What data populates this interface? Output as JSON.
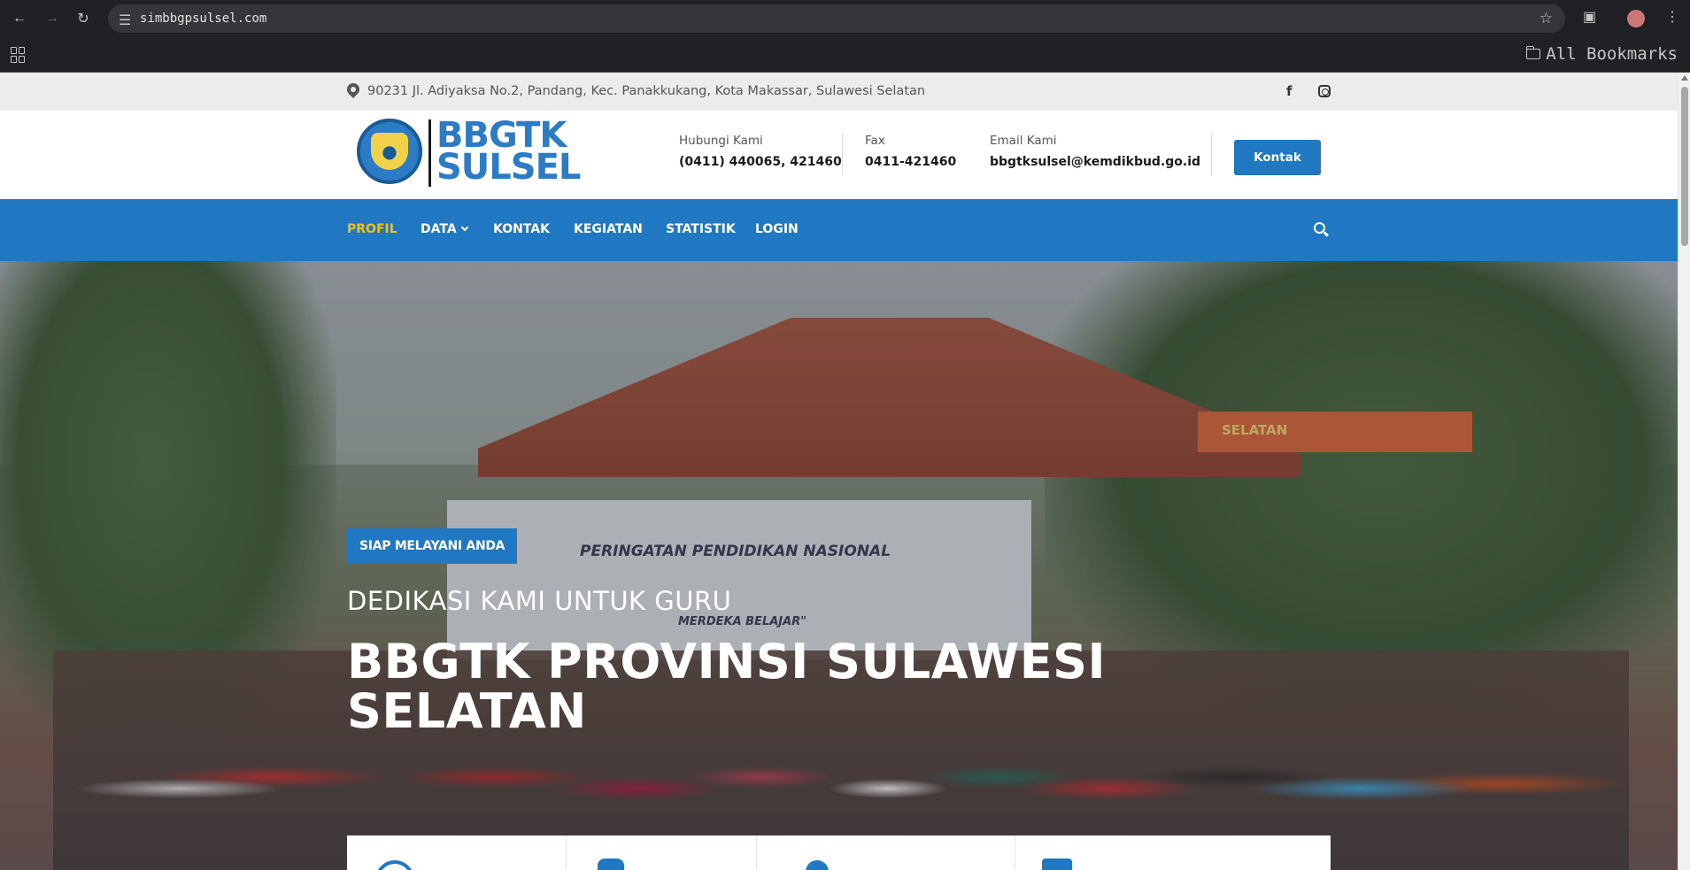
{
  "browser": {
    "url": "simbbgpsulsel.com",
    "bookmarks_label": "All Bookmarks"
  },
  "topbar": {
    "address": "90231 Jl. Adiyaksa No.2, Pandang, Kec. Panakkukang, Kota Makassar, Sulawesi Selatan",
    "facebook_glyph": "f"
  },
  "header": {
    "logo_line1": "BBGTK",
    "logo_line2": "SULSEL",
    "contacts": [
      {
        "label": "Hubungi Kami",
        "value": "(0411) 440065, 421460"
      },
      {
        "label": "Fax",
        "value": "0411-421460"
      },
      {
        "label": "Email Kami",
        "value": "bbgtksulsel@kemdikbud.go.id"
      }
    ],
    "cta_label": "Kontak"
  },
  "nav": {
    "items": [
      "PROFIL",
      "DATA",
      "KONTAK",
      "KEGIATAN",
      "STATISTIK",
      "LOGIN"
    ],
    "active_color": "#f1c40f"
  },
  "hero": {
    "badge": "SIAP MELAYANI ANDA",
    "subtitle": "DEDIKASI KAMI UNTUK GURU",
    "title": "BBGTK PROVINSI SULAWESI SELATAN",
    "banner_line1": "PERINGATAN PENDIDIKAN NASIONAL",
    "banner_line2": "MERDEKA BELAJAR\"",
    "sign_text": "SELATAN"
  },
  "colors": {
    "brand_blue": "#1f78c1",
    "topbar_bg": "#ececec"
  }
}
